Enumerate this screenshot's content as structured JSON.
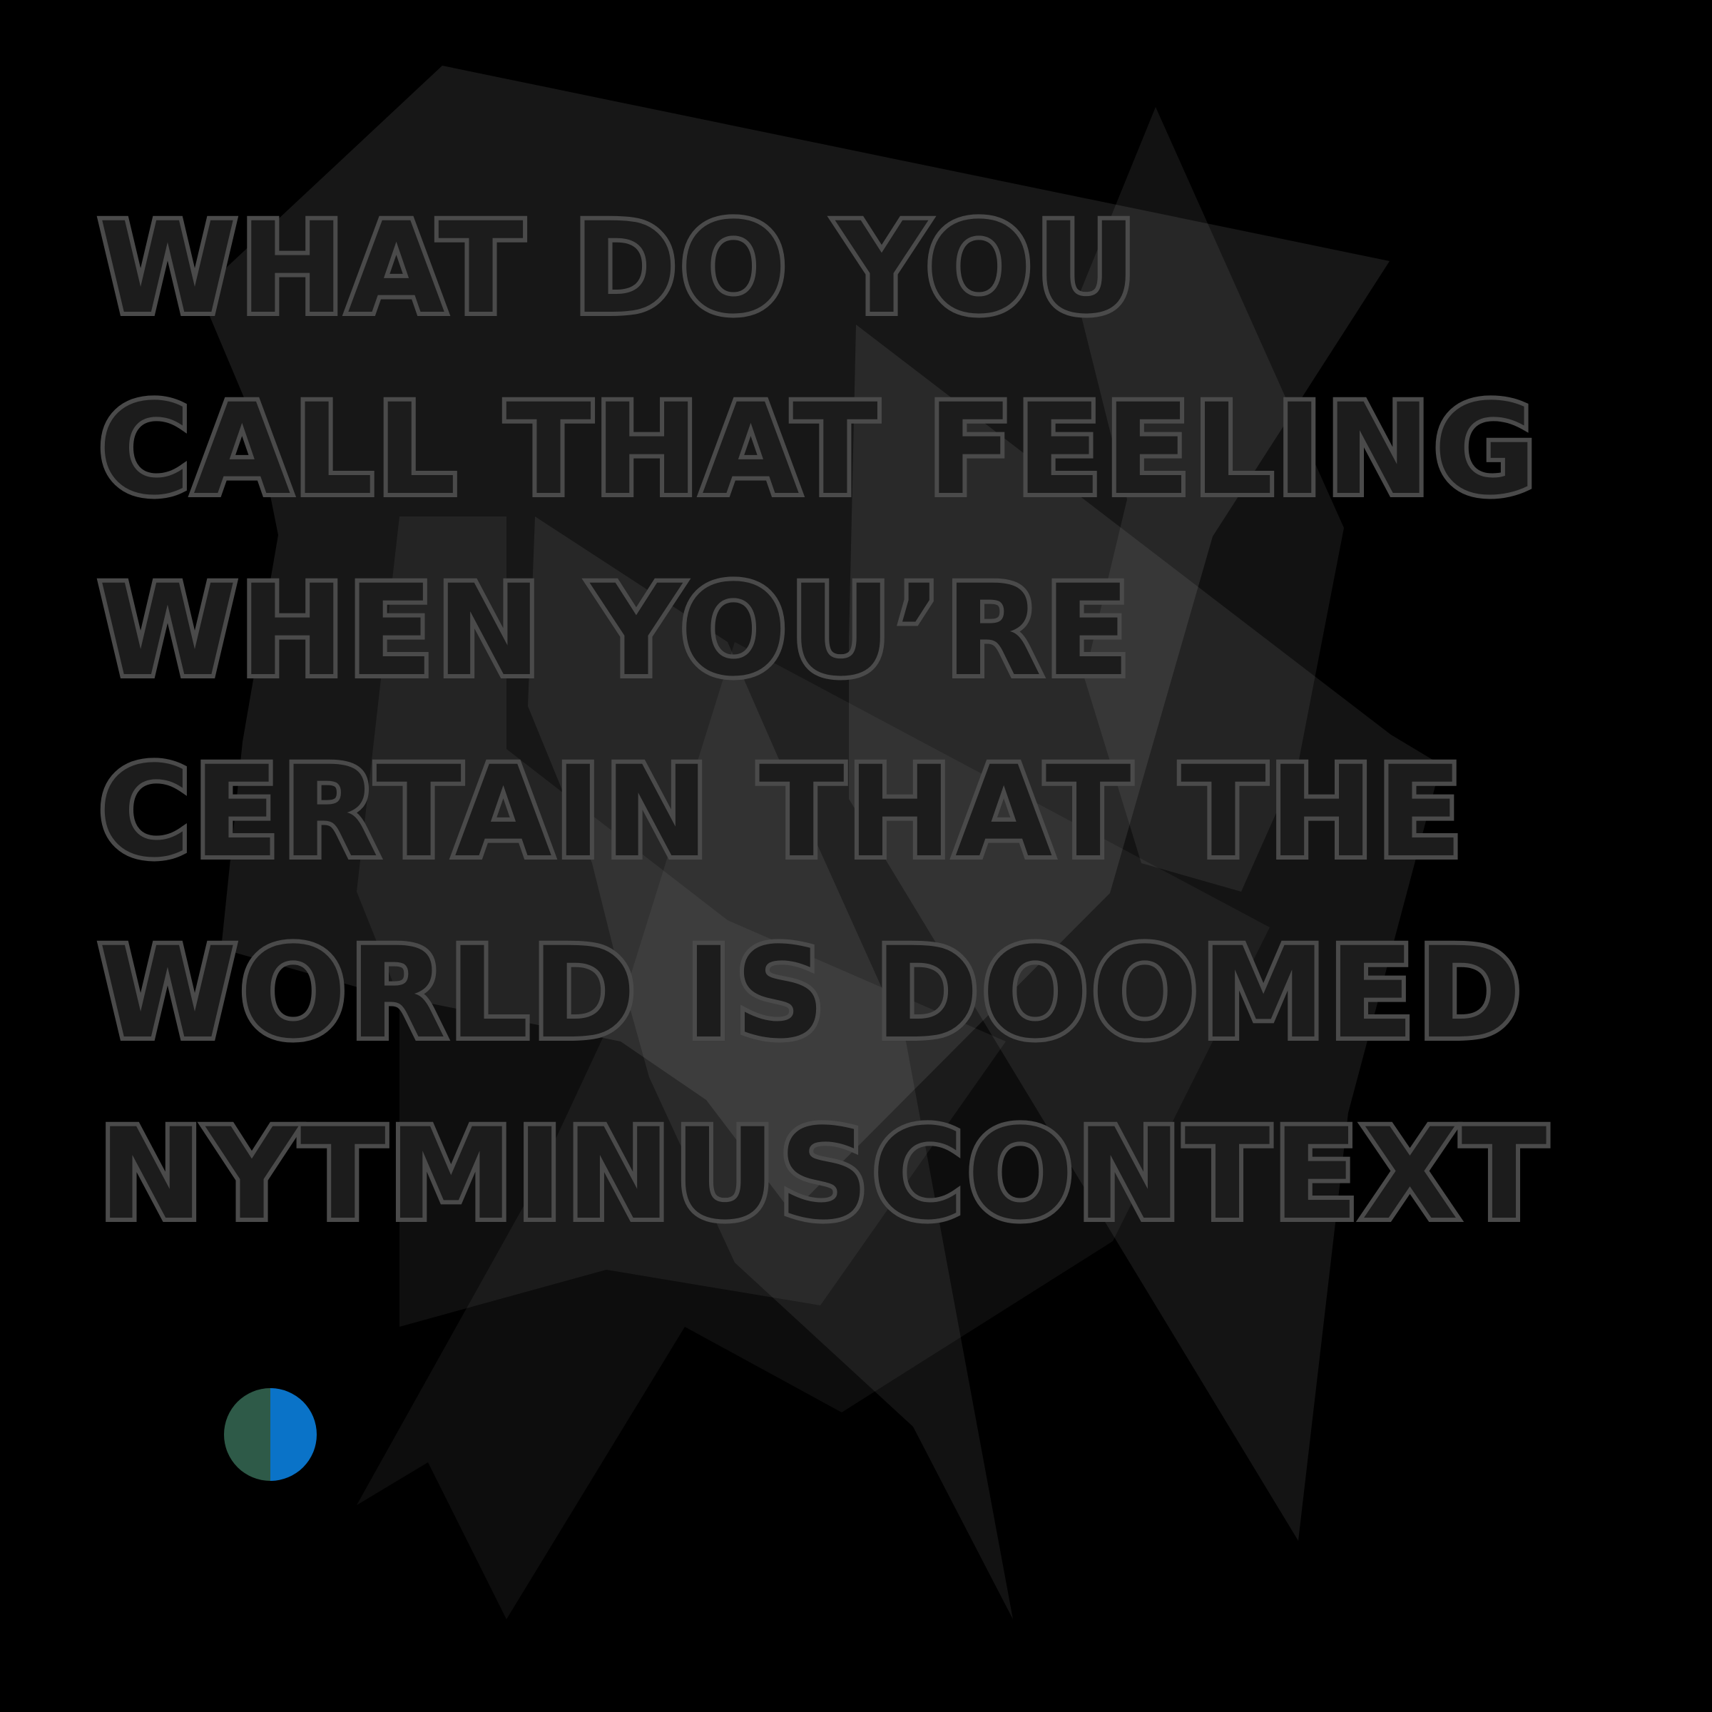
{
  "poster": {
    "background_color": "#000000",
    "text_fill_color": "#1c1c1c",
    "text_outline_color": "#4a4a4a",
    "lines": [
      "What do you",
      "call that feeling",
      "when you’re",
      "certain that the",
      "world is doomed",
      "nytminuscontext"
    ]
  },
  "logo": {
    "name": "nyt-minus-context-logo-dot",
    "left_color": "#2e5a48",
    "right_color": "#0a73c8"
  }
}
